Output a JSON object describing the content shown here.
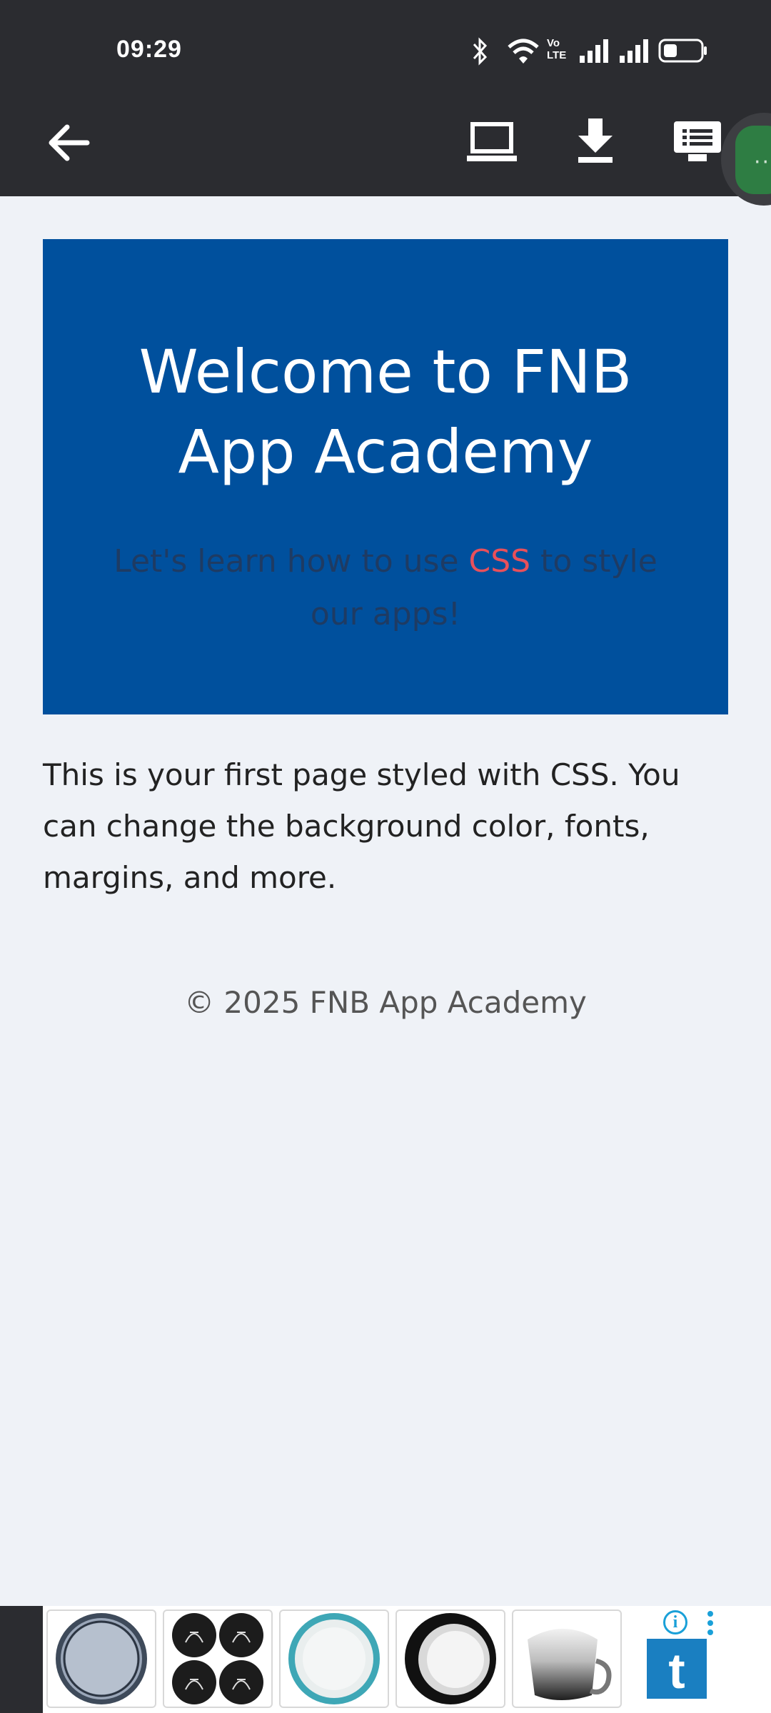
{
  "status_bar": {
    "time": "09:29",
    "icons": [
      "bluetooth-icon",
      "wifi-icon",
      "volte-icon",
      "signal-icon",
      "signal-icon",
      "battery-icon"
    ],
    "volte_label": "Vo LTE"
  },
  "app_bar": {
    "icons": [
      "back-arrow-icon",
      "laptop-icon",
      "download-icon",
      "slideshow-icon"
    ],
    "fab_label": "··"
  },
  "hero": {
    "title": "Welcome to FNB App Academy",
    "subtitle_before": "Let's learn how to use ",
    "subtitle_accent": "CSS",
    "subtitle_after": " to style our apps!",
    "background_color": "#00509d",
    "accent_color": "#e8505b"
  },
  "intro_text": "This is your first page styled with CSS. You can change the background color, fonts, margins, and more.",
  "footer_text": "© 2025 FNB App Academy",
  "ad_banner": {
    "products": [
      "grey-plate",
      "illustrated-coasters",
      "teal-rim-bowl",
      "black-rim-plate",
      "gradient-mug"
    ],
    "logo_letter": "t",
    "info_icon": "info-icon",
    "more_icon": "more-vert-icon"
  }
}
